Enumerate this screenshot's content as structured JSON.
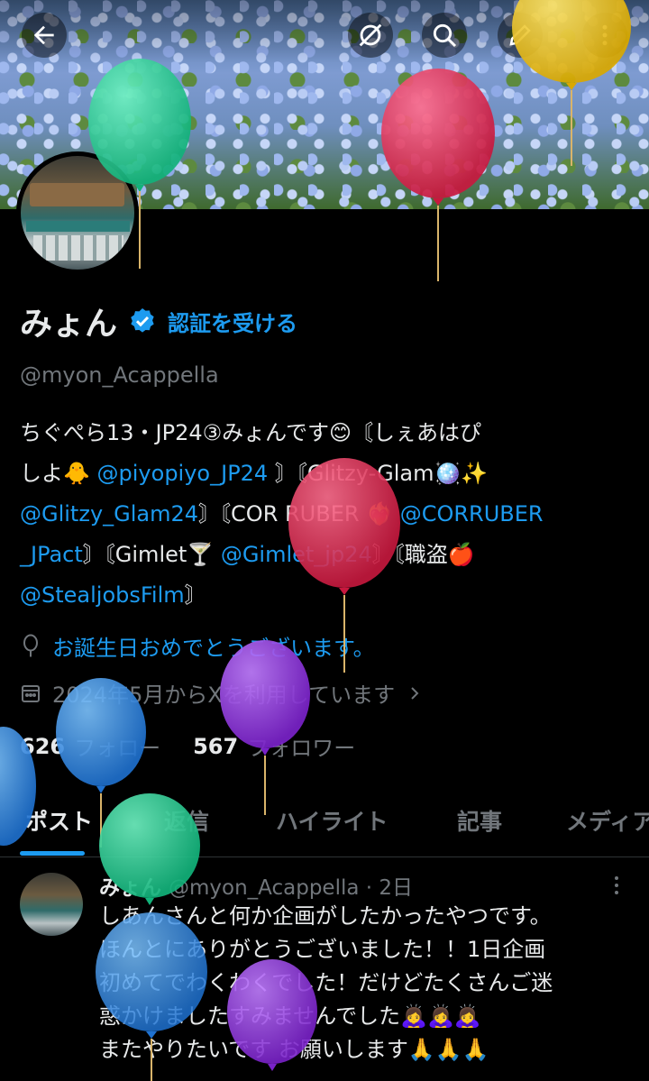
{
  "profile": {
    "name": "みょん",
    "verify_label": "認証を受ける",
    "handle": "@myon_Acappella",
    "bio": {
      "line1": "ちぐぺら13・JP24③みょんです😊〘しぇあはぴ",
      "line2_text": "しよ🐥",
      "mention1": "@piyopiyo_JP24",
      "line2_rest": "〙〘Glitzy-Glam🪩✨",
      "mention2": "@Glitzy_Glam24",
      "line3_rest": "〙〘COR RUBER ❤️‍🔥",
      "mention3": "@CORRUBER",
      "mention3b": "_JPact",
      "line4_mid": "〙〘Gimlet🍸",
      "mention4": "@Gimlet_jp24",
      "line4_rest": "〙〘職盗🍎",
      "mention5": "@StealjobsFilm",
      "line5_rest": "〙"
    },
    "birthday": "お誕生日おめでとうございます。",
    "joined": "2024年5月からXを利用しています",
    "following_count": "626",
    "following_label": "フォロー",
    "followers_count": "567",
    "followers_label": "フォロワー"
  },
  "tabs": [
    "ポスト",
    "返信",
    "ハイライト",
    "記事",
    "メディア"
  ],
  "post": {
    "name": "みょん",
    "handle_time": "@myon_Acappella · 2日",
    "lines": [
      "しあんさんと何か企画がしたかったやつです。",
      "ほんとにありがとうございました！！1日企画",
      "初めてでわくわくでした！だけどたくさんご迷",
      "惑かけましたすみませんでした🙇‍♀️🙇‍♀️🙇‍♀️",
      "またやりたいです お願いします🙏🙏🙏"
    ]
  },
  "icons": {
    "back": "back-arrow-icon",
    "sync": "sync-off-icon",
    "search": "search-icon",
    "edit": "pencil-icon",
    "more": "more-vertical-icon",
    "verified": "verified-badge-icon",
    "balloon": "balloon-icon",
    "calendar": "calendar-icon"
  },
  "colors": {
    "accent": "#1d9bf0",
    "muted": "#71767b",
    "text": "#e7e9ea",
    "background": "#000000"
  }
}
